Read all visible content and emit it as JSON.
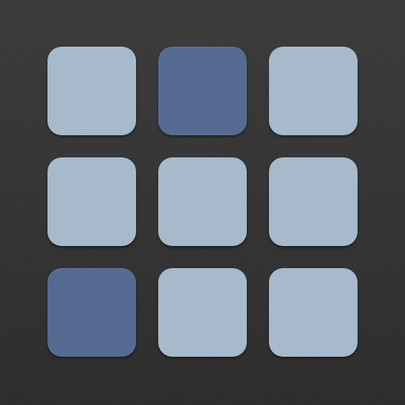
{
  "colors": {
    "background": "#323232",
    "tile_off": "#a6bacb",
    "tile_on": "#566b91"
  },
  "grid": {
    "rows": 3,
    "cols": 3,
    "tiles": [
      {
        "state": "off"
      },
      {
        "state": "on"
      },
      {
        "state": "off"
      },
      {
        "state": "off"
      },
      {
        "state": "off"
      },
      {
        "state": "off"
      },
      {
        "state": "on"
      },
      {
        "state": "off"
      },
      {
        "state": "off"
      }
    ]
  }
}
